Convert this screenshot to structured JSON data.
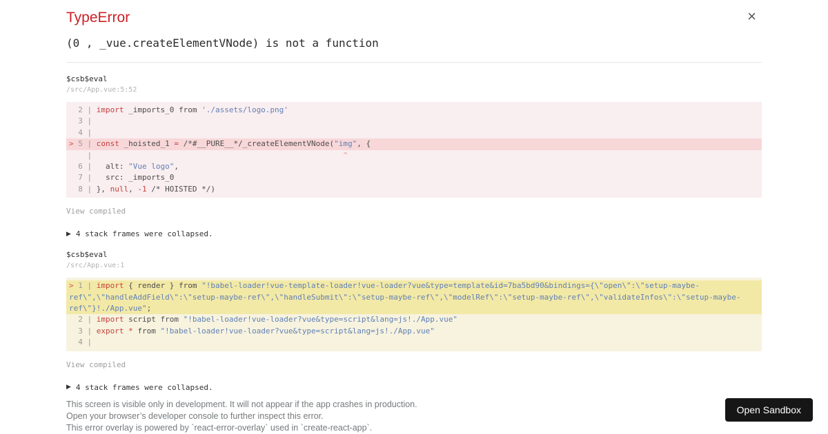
{
  "page": {
    "title": "TypeError",
    "message": "(0 , _vue.createElementVNode) is not a function"
  },
  "icons": {
    "close": "×",
    "expand_triangle": "▶"
  },
  "colors": {
    "accent_red": "#cd2027",
    "keyword_red": "#c4423e",
    "string_blue": "#6080b5",
    "block_red_bg": "#f9eef0",
    "block_red_highlight": "#f8d7d9",
    "block_yellow_bg": "#f7f3df",
    "block_yellow_highlight": "#f3e9a6",
    "button_bg": "#161616"
  },
  "frames": [
    {
      "function": "$csb$eval",
      "location": "/src/App.vue:5:52",
      "theme": "red",
      "view_compiled": "View compiled",
      "collapsed": "4 stack frames were collapsed.",
      "code": [
        {
          "hl": false,
          "segs": [
            [
              "  2 | ",
              "g"
            ],
            [
              "import",
              "k"
            ],
            [
              " _imports_0 from ",
              "d"
            ],
            [
              "'./assets/logo.png'",
              "s"
            ]
          ]
        },
        {
          "hl": false,
          "segs": [
            [
              "  3 |",
              "g"
            ]
          ]
        },
        {
          "hl": false,
          "segs": [
            [
              "  4 |",
              "g"
            ]
          ]
        },
        {
          "hl": true,
          "segs": [
            [
              "> ",
              "m"
            ],
            [
              "5 | ",
              "g"
            ],
            [
              "const",
              "k"
            ],
            [
              " _hoisted_1 ",
              "d"
            ],
            [
              "=",
              "k"
            ],
            [
              " /*#__PURE__*/_createElementVNode(",
              "d"
            ],
            [
              "\"img\"",
              "s"
            ],
            [
              ", {",
              "d"
            ]
          ]
        },
        {
          "hl": false,
          "segs": [
            [
              "    | ",
              "g"
            ],
            [
              "                                                      ",
              "d"
            ],
            [
              "^",
              "x"
            ]
          ]
        },
        {
          "hl": false,
          "segs": [
            [
              "  6 | ",
              "g"
            ],
            [
              "  alt: ",
              "d"
            ],
            [
              "\"Vue logo\"",
              "s"
            ],
            [
              ",",
              "d"
            ]
          ]
        },
        {
          "hl": false,
          "segs": [
            [
              "  7 | ",
              "g"
            ],
            [
              "  src: _imports_0",
              "d"
            ]
          ]
        },
        {
          "hl": false,
          "segs": [
            [
              "  8 | ",
              "g"
            ],
            [
              "}, ",
              "d"
            ],
            [
              "null",
              "k"
            ],
            [
              ", ",
              "d"
            ],
            [
              "-1",
              "k"
            ],
            [
              " /* HOISTED */)",
              "d"
            ]
          ]
        }
      ]
    },
    {
      "function": "$csb$eval",
      "location": "/src/App.vue:1",
      "theme": "yellow",
      "view_compiled": "View compiled",
      "collapsed": "4 stack frames were collapsed.",
      "code": [
        {
          "hl": true,
          "segs": [
            [
              "> ",
              "m"
            ],
            [
              "1 | ",
              "g"
            ],
            [
              "import",
              "k"
            ],
            [
              " { render } from ",
              "d"
            ],
            [
              "\"!babel-loader!vue-template-loader!vue-loader?vue&type=template&id=7ba5bd90&bindings={\\\"open\\\":\\\"setup-maybe-ref\\\",\\\"handleAddField\\\":\\\"setup-maybe-ref\\\",\\\"handleSubmit\\\":\\\"setup-maybe-ref\\\",\\\"modelRef\\\":\\\"setup-maybe-ref\\\",\\\"validateInfos\\\":\\\"setup-maybe-ref\\\"}!./App.vue\"",
              "s"
            ],
            [
              ";",
              "d"
            ]
          ]
        },
        {
          "hl": false,
          "segs": [
            [
              "  2 | ",
              "g"
            ],
            [
              "import",
              "k"
            ],
            [
              " script from ",
              "d"
            ],
            [
              "\"!babel-loader!vue-loader?vue&type=script&lang=js!./App.vue\"",
              "s"
            ]
          ]
        },
        {
          "hl": false,
          "segs": [
            [
              "  3 | ",
              "g"
            ],
            [
              "export",
              "k"
            ],
            [
              " ",
              "d"
            ],
            [
              "*",
              "k"
            ],
            [
              " from ",
              "d"
            ],
            [
              "\"!babel-loader!vue-loader?vue&type=script&lang=js!./App.vue\"",
              "s"
            ]
          ]
        },
        {
          "hl": false,
          "segs": [
            [
              "  4 |",
              "g"
            ]
          ]
        }
      ]
    }
  ],
  "footer": {
    "lines": [
      "This screen is visible only in development. It will not appear if the app crashes in production.",
      "Open your browser’s developer console to further inspect this error.",
      "This error overlay is powered by `react-error-overlay` used in `create-react-app`."
    ]
  },
  "open_sandbox_label": "Open Sandbox"
}
